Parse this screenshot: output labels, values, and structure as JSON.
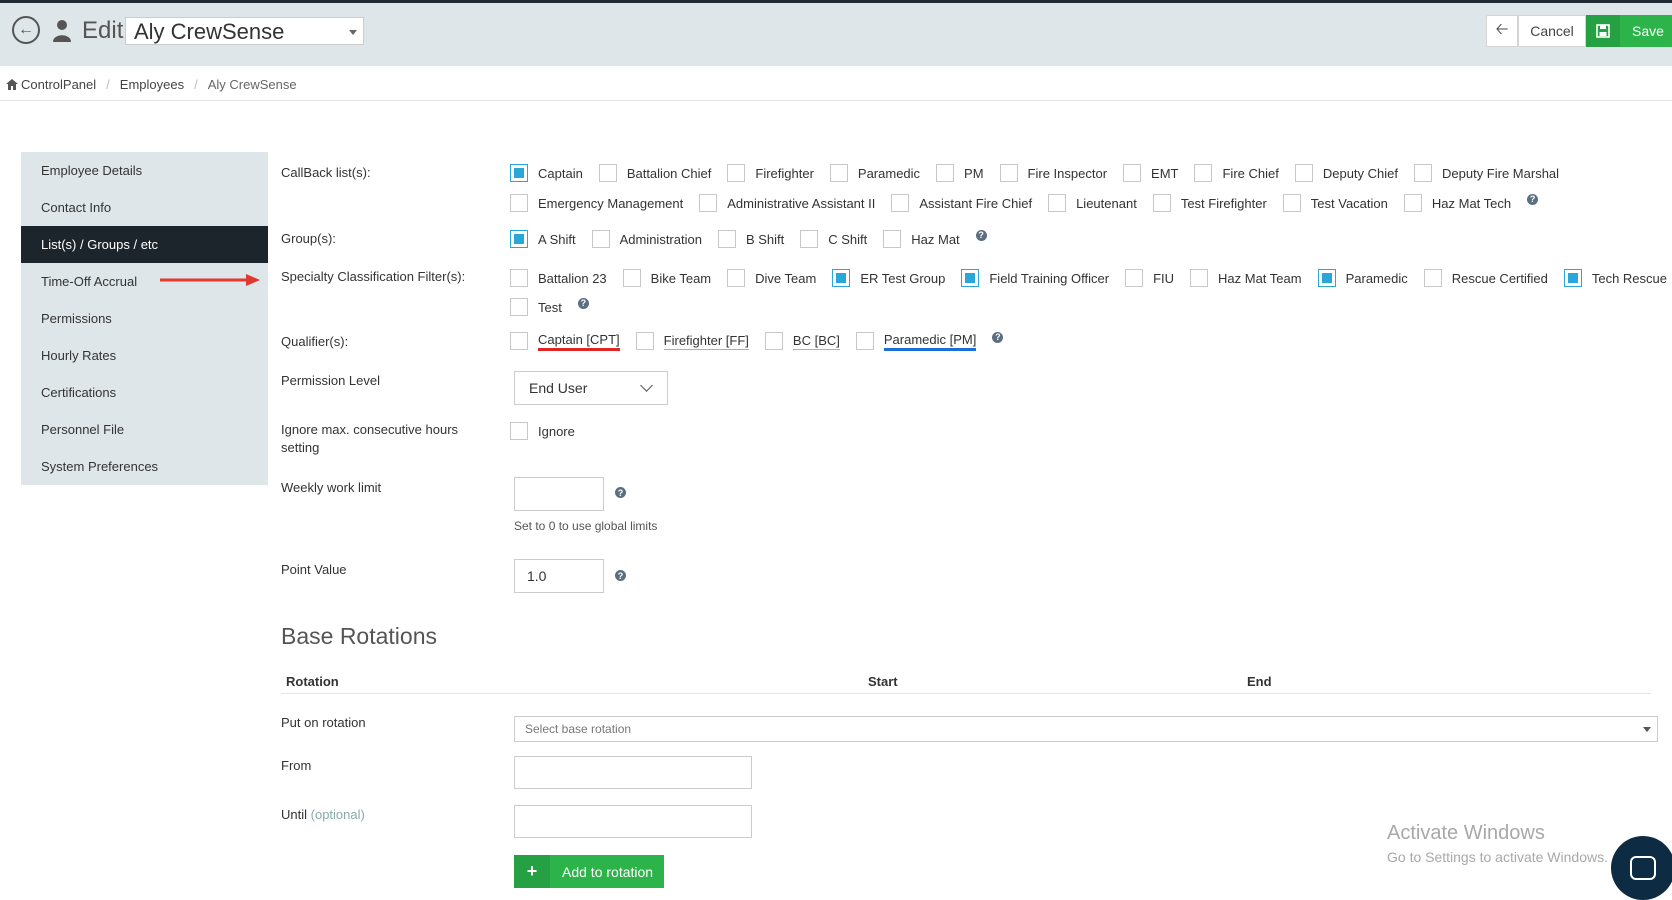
{
  "header": {
    "edit_label": "Edit",
    "employee_name": "Aly CrewSense",
    "cancel_label": "Cancel",
    "save_label": "Save"
  },
  "breadcrumb": {
    "root": "ControlPanel",
    "section": "Employees",
    "current": "Aly CrewSense"
  },
  "sidebar": {
    "items": [
      {
        "label": "Employee Details",
        "active": false
      },
      {
        "label": "Contact Info",
        "active": false
      },
      {
        "label": "List(s) / Groups / etc",
        "active": true
      },
      {
        "label": "Time-Off Accrual",
        "active": false
      },
      {
        "label": "Permissions",
        "active": false
      },
      {
        "label": "Hourly Rates",
        "active": false
      },
      {
        "label": "Certifications",
        "active": false
      },
      {
        "label": "Personnel File",
        "active": false
      },
      {
        "label": "System Preferences",
        "active": false
      }
    ]
  },
  "form": {
    "callback_label": "CallBack list(s):",
    "callback_row1": [
      {
        "label": "Captain",
        "checked": true
      },
      {
        "label": "Battalion Chief",
        "checked": false
      },
      {
        "label": "Firefighter",
        "checked": false
      },
      {
        "label": "Paramedic",
        "checked": false
      },
      {
        "label": "PM",
        "checked": false
      },
      {
        "label": "Fire Inspector",
        "checked": false
      },
      {
        "label": "EMT",
        "checked": false
      },
      {
        "label": "Fire Chief",
        "checked": false
      },
      {
        "label": "Deputy Chief",
        "checked": false
      },
      {
        "label": "Deputy Fire Marshal",
        "checked": false
      }
    ],
    "callback_row2": [
      {
        "label": "Emergency Management",
        "checked": false
      },
      {
        "label": "Administrative Assistant II",
        "checked": false
      },
      {
        "label": "Assistant Fire Chief",
        "checked": false
      },
      {
        "label": "Lieutenant",
        "checked": false
      },
      {
        "label": "Test Firefighter",
        "checked": false
      },
      {
        "label": "Test Vacation",
        "checked": false
      },
      {
        "label": "Haz Mat Tech",
        "checked": false
      }
    ],
    "groups_label": "Group(s):",
    "groups": [
      {
        "label": "A Shift",
        "checked": true
      },
      {
        "label": "Administration",
        "checked": false
      },
      {
        "label": "B Shift",
        "checked": false
      },
      {
        "label": "C Shift",
        "checked": false
      },
      {
        "label": "Haz Mat",
        "checked": false
      }
    ],
    "specialty_label": "Specialty Classification Filter(s):",
    "specialty_row1": [
      {
        "label": "Battalion 23",
        "checked": false
      },
      {
        "label": "Bike Team",
        "checked": false
      },
      {
        "label": "Dive Team",
        "checked": false
      },
      {
        "label": "ER Test Group",
        "checked": true
      },
      {
        "label": "Field Training Officer",
        "checked": true
      },
      {
        "label": "FIU",
        "checked": false
      },
      {
        "label": "Haz Mat Team",
        "checked": false
      },
      {
        "label": "Paramedic",
        "checked": true
      },
      {
        "label": "Rescue Certified",
        "checked": false
      },
      {
        "label": "Tech Rescue",
        "checked": true
      }
    ],
    "specialty_row2": [
      {
        "label": "Test",
        "checked": false
      }
    ],
    "qualifiers_label": "Qualifier(s):",
    "qualifiers": [
      {
        "label": "Captain [CPT]",
        "checked": false
      },
      {
        "label": "Firefighter [FF]",
        "checked": false
      },
      {
        "label": "BC [BC]",
        "checked": false
      },
      {
        "label": "Paramedic [PM]",
        "checked": false
      }
    ],
    "permission_label": "Permission Level",
    "permission_value": "End User",
    "ignore_label_line1": "Ignore max. consecutive hours",
    "ignore_label_line2": "setting",
    "ignore_checkbox_label": "Ignore",
    "weekly_label": "Weekly work limit",
    "weekly_value": "",
    "weekly_hint": "Set to 0 to use global limits",
    "point_label": "Point Value",
    "point_value": "1.0"
  },
  "rotations": {
    "title": "Base Rotations",
    "col_rotation": "Rotation",
    "col_start": "Start",
    "col_end": "End",
    "put_label": "Put on rotation",
    "select_placeholder": "Select base rotation",
    "from_label": "From",
    "until_label": "Until",
    "until_optional": "(optional)",
    "add_button": "Add to rotation"
  },
  "watermark": {
    "line1": "Activate Windows",
    "line2": "Go to Settings to activate Windows."
  },
  "colors": {
    "accent_blue": "#2aa6d8",
    "save_green": "#2cb34a",
    "nav_active": "#1d252c"
  }
}
